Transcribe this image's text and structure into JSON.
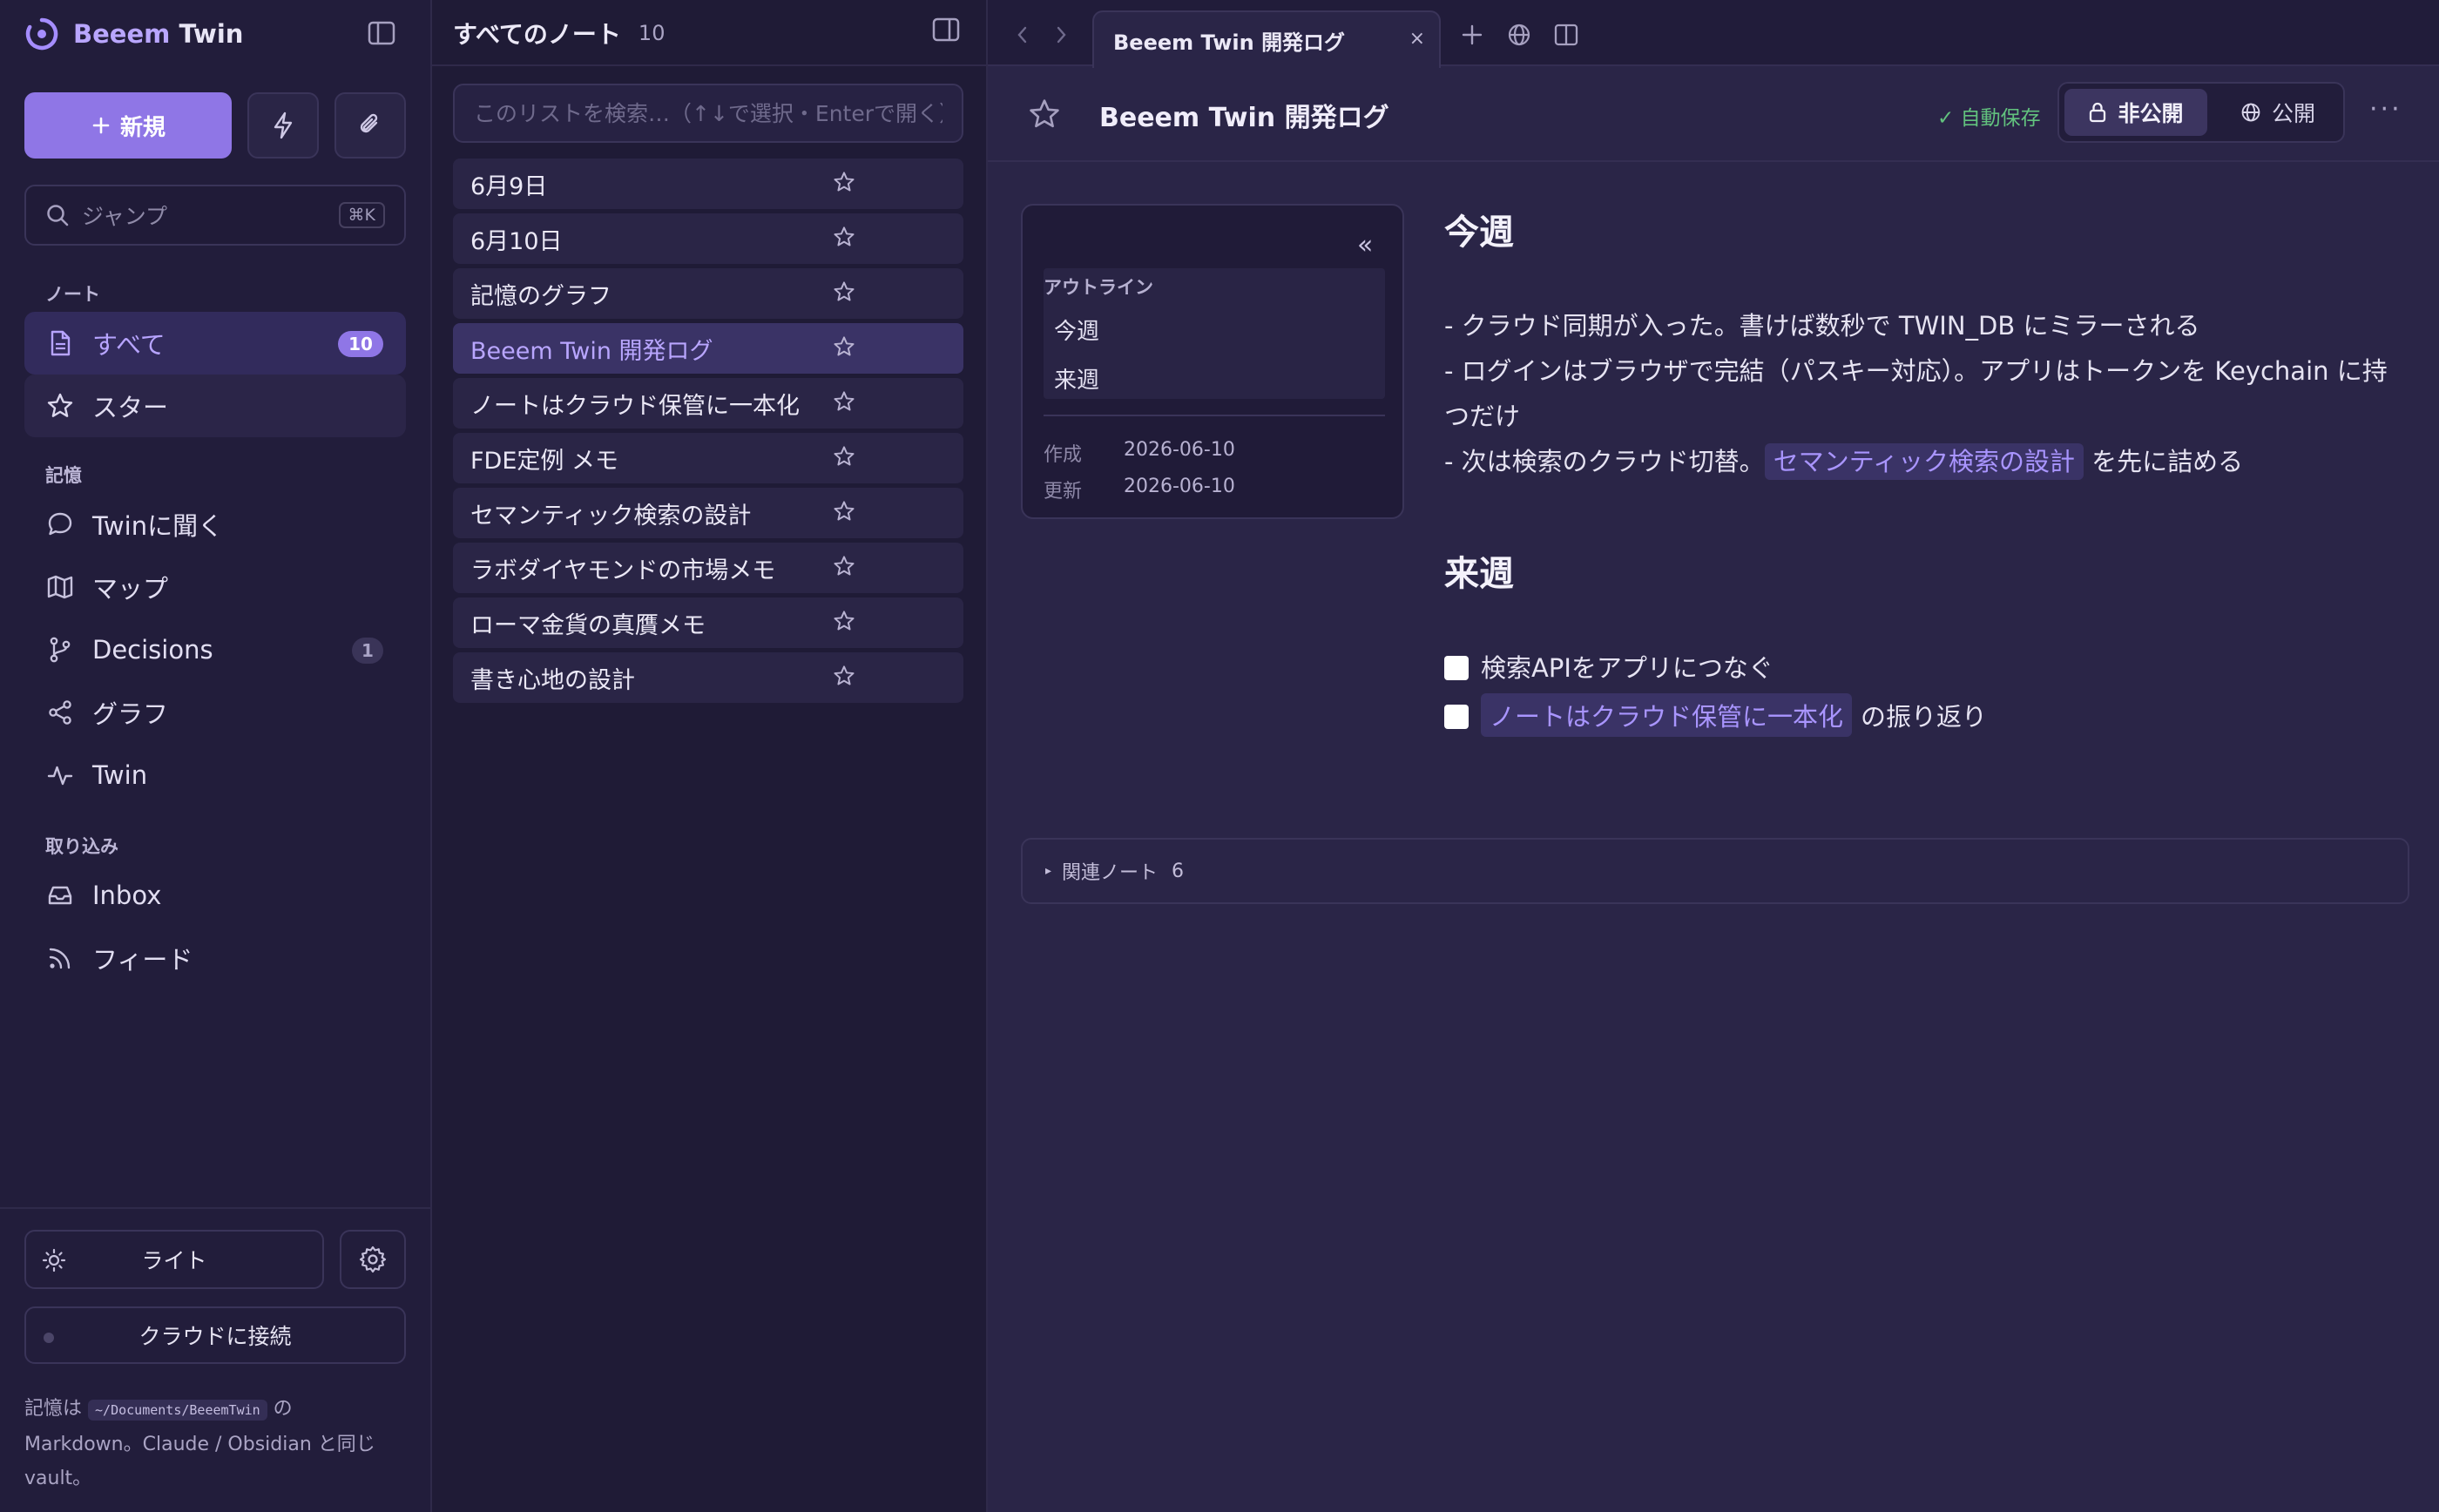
{
  "app": {
    "brand_prefix": "Beeem",
    "brand_suffix": "Twin"
  },
  "sidebar": {
    "new_button": "新規",
    "jump": {
      "placeholder": "ジャンプ",
      "shortcut": "⌘K"
    },
    "section_notes": "ノート",
    "section_memory": "記憶",
    "section_import": "取り込み",
    "items": [
      {
        "label": "すべて",
        "badge": "10"
      },
      {
        "label": "スター"
      },
      {
        "label": "Twinに聞く"
      },
      {
        "label": "マップ"
      },
      {
        "label": "Decisions",
        "badge": "1"
      },
      {
        "label": "グラフ"
      },
      {
        "label": "Twin"
      },
      {
        "label": "Inbox"
      },
      {
        "label": "フィード"
      }
    ],
    "theme_button": "ライト",
    "cloud_button": "クラウドに接続",
    "vault_note": {
      "prefix": "記憶は",
      "path": "~/Documents/BeeemTwin",
      "suffix": "の Markdown。Claude / Obsidian と同じ vault。"
    }
  },
  "note_list": {
    "title": "すべてのノート",
    "count": "10",
    "search_placeholder": "このリストを検索…（↑↓で選択・Enterで開く）",
    "notes": [
      {
        "title": "6月9日"
      },
      {
        "title": "6月10日"
      },
      {
        "title": "記憶のグラフ"
      },
      {
        "title": "Beeem Twin 開発ログ"
      },
      {
        "title": "ノートはクラウド保管に一本化"
      },
      {
        "title": "FDE定例 メモ"
      },
      {
        "title": "セマンティック検索の設計"
      },
      {
        "title": "ラボダイヤモンドの市場メモ"
      },
      {
        "title": "ローマ金貨の真贋メモ"
      },
      {
        "title": "書き心地の設計"
      }
    ],
    "selected_index": 3
  },
  "editor": {
    "tab_title": "Beeem Twin 開発ログ",
    "tab_close": "×",
    "doc_title": "Beeem Twin 開発ログ",
    "autosave": "✓ 自動保存",
    "private_label": "非公開",
    "public_label": "公開",
    "more": "···",
    "outline": {
      "label": "アウトライン",
      "collapse": "«",
      "items": [
        "今週",
        "来週"
      ],
      "created_label": "作成",
      "created": "2026-06-10",
      "updated_label": "更新",
      "updated": "2026-06-10"
    },
    "sections": [
      {
        "heading": "今週",
        "lines": [
          "- クラウド同期が入った。書けば数秒で TWIN_DB にミラーされる",
          "- ログインはブラウザで完結（パスキー対応）。アプリはトークンを Keychain に持つだけ"
        ],
        "link_line": {
          "prefix": "- 次は検索のクラウド切替。",
          "link": "セマンティック検索の設計",
          "suffix": "を先に詰める"
        }
      },
      {
        "heading": "来週",
        "tasks": [
          {
            "text": "検索APIをアプリにつなぐ",
            "checked": false
          },
          {
            "link": "ノートはクラウド保管に一本化",
            "suffix": "の振り返り",
            "checked": false
          }
        ]
      }
    ],
    "related": {
      "label": "関連ノート",
      "count": "6"
    }
  },
  "colors": {
    "accent": "#8f76e6",
    "accent_text": "#b9a6ff",
    "autosave_green": "#62c27e"
  },
  "icons": {
    "brand": "circle-logo-icon",
    "quick": "lightning-icon",
    "attach": "paperclip-icon"
  }
}
